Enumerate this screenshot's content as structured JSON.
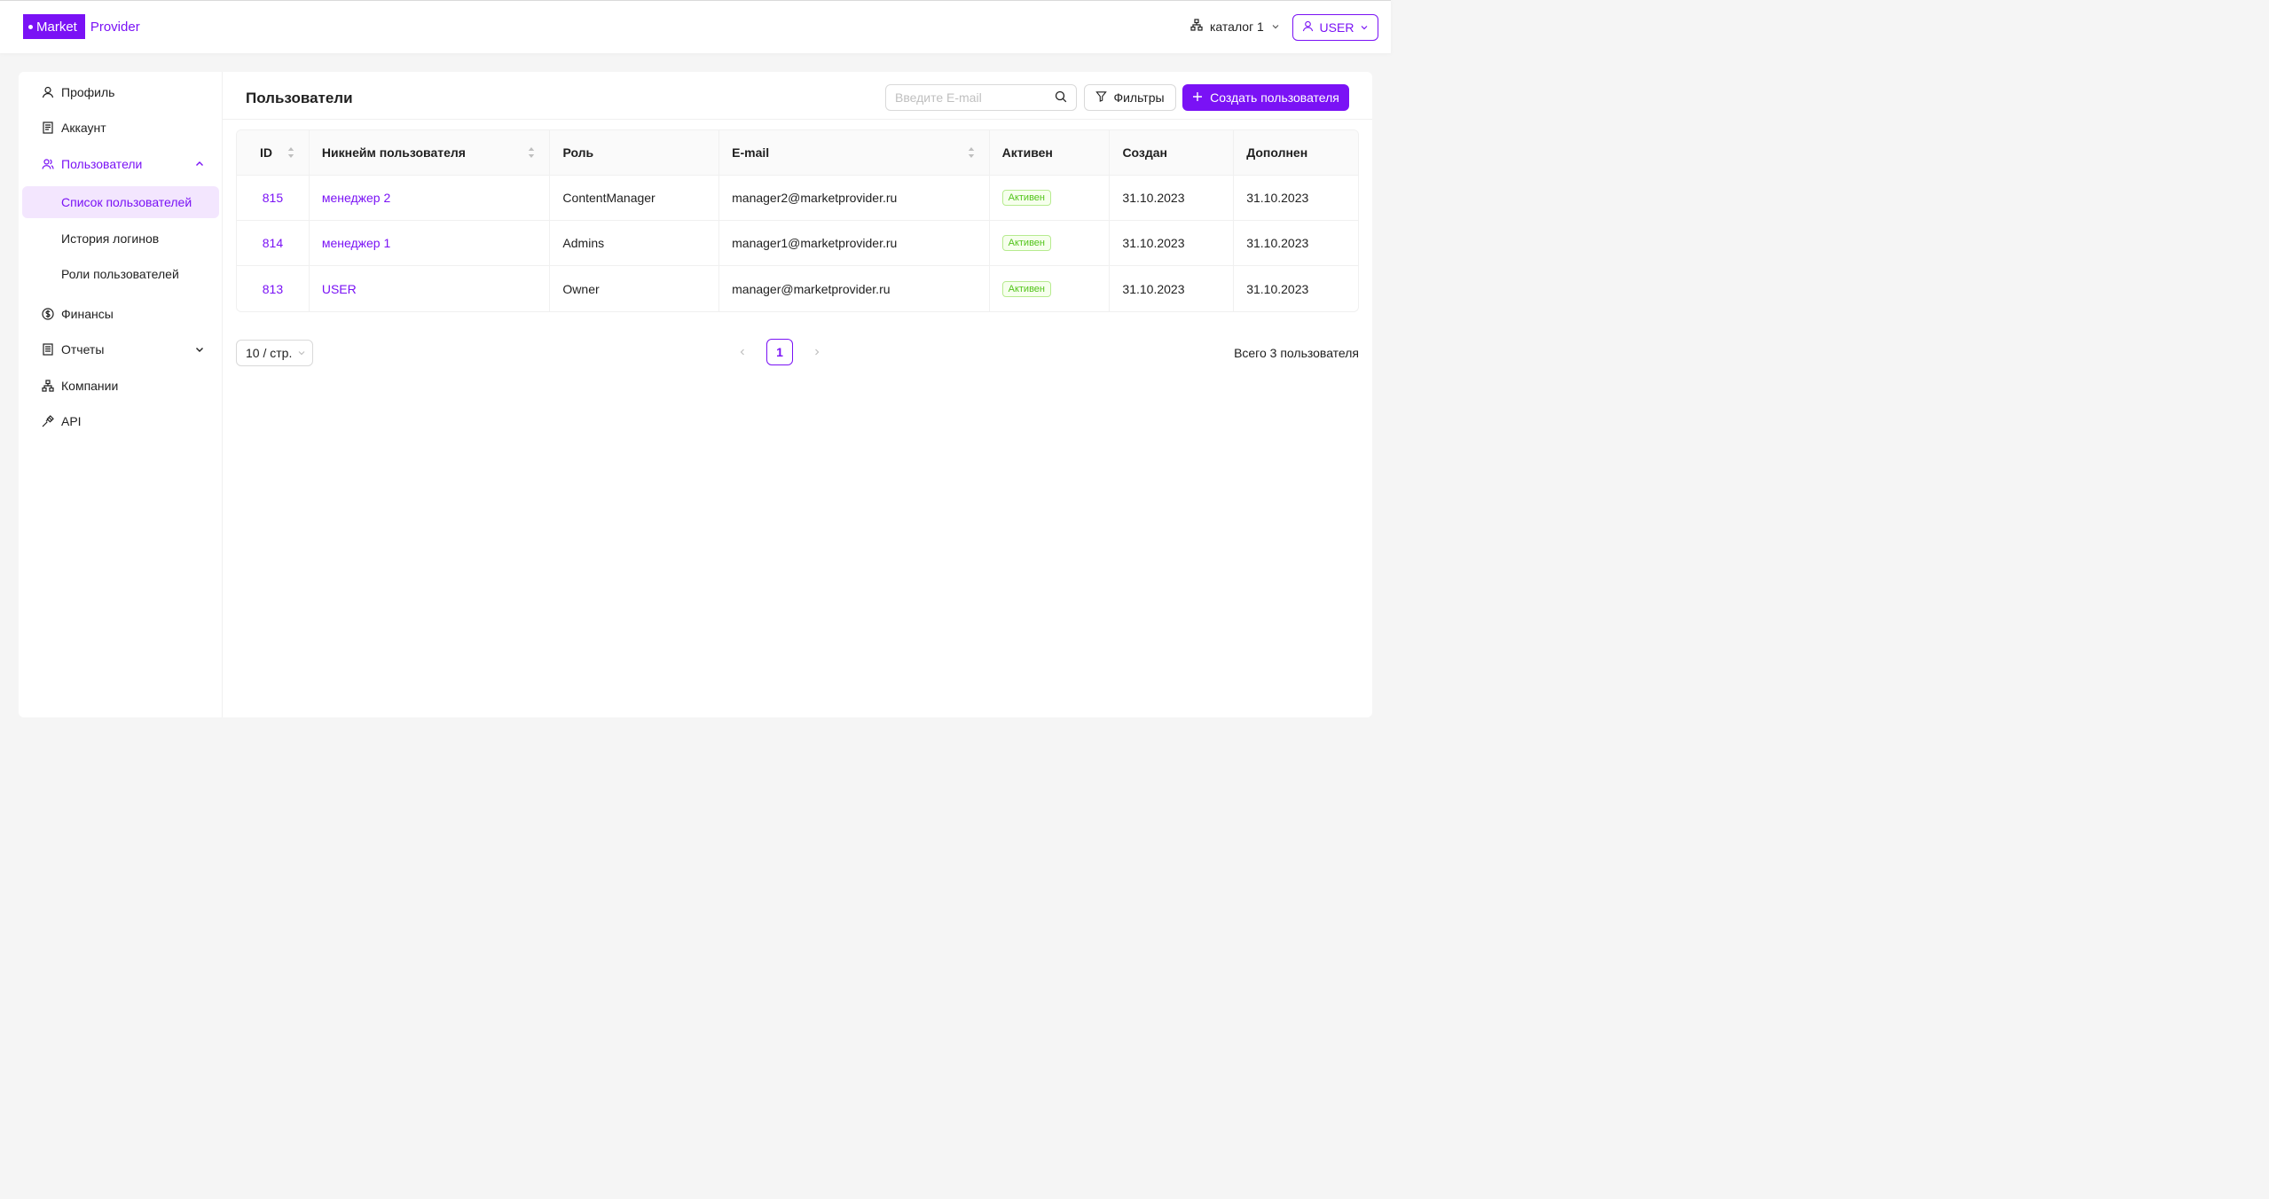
{
  "header": {
    "logo_market": "Market",
    "logo_provider": "Provider",
    "catalog_label": "каталог 1",
    "user_label": "USER"
  },
  "sidebar": {
    "items": [
      {
        "label": "Профиль",
        "icon": "user-icon"
      },
      {
        "label": "Аккаунт",
        "icon": "document-icon"
      },
      {
        "label": "Пользователи",
        "icon": "users-icon",
        "active": true,
        "expanded": true
      },
      {
        "label": "Финансы",
        "icon": "dollar-icon"
      },
      {
        "label": "Отчеты",
        "icon": "report-icon",
        "expanded": false
      },
      {
        "label": "Компании",
        "icon": "hierarchy-icon"
      },
      {
        "label": "API",
        "icon": "plug-icon"
      }
    ],
    "subitems": [
      {
        "label": "Список пользователей",
        "selected": true
      },
      {
        "label": "История логинов"
      },
      {
        "label": "Роли пользователей"
      }
    ]
  },
  "main": {
    "title": "Пользователи",
    "search_placeholder": "Введите E-mail",
    "filters_label": "Фильтры",
    "create_label": "Создать пользователя"
  },
  "table": {
    "columns": [
      "ID",
      "Никнейм пользователя",
      "Роль",
      "E-mail",
      "Активен",
      "Создан",
      "Дополнен"
    ],
    "rows": [
      {
        "id": "815",
        "nickname": "менеджер 2",
        "role": "ContentManager",
        "email": "manager2@marketprovider.ru",
        "active": "Активен",
        "created": "31.10.2023",
        "added": "31.10.2023"
      },
      {
        "id": "814",
        "nickname": "менеджер 1",
        "role": "Admins",
        "email": "manager1@marketprovider.ru",
        "active": "Активен",
        "created": "31.10.2023",
        "added": "31.10.2023"
      },
      {
        "id": "813",
        "nickname": "USER",
        "role": "Owner",
        "email": "manager@marketprovider.ru",
        "active": "Активен",
        "created": "31.10.2023",
        "added": "31.10.2023"
      }
    ]
  },
  "pagination": {
    "page_size": "10 / стр.",
    "current_page": "1",
    "total": "Всего 3 пользователя"
  },
  "colors": {
    "accent": "#7a12f5",
    "active_badge": "#52c41a"
  }
}
